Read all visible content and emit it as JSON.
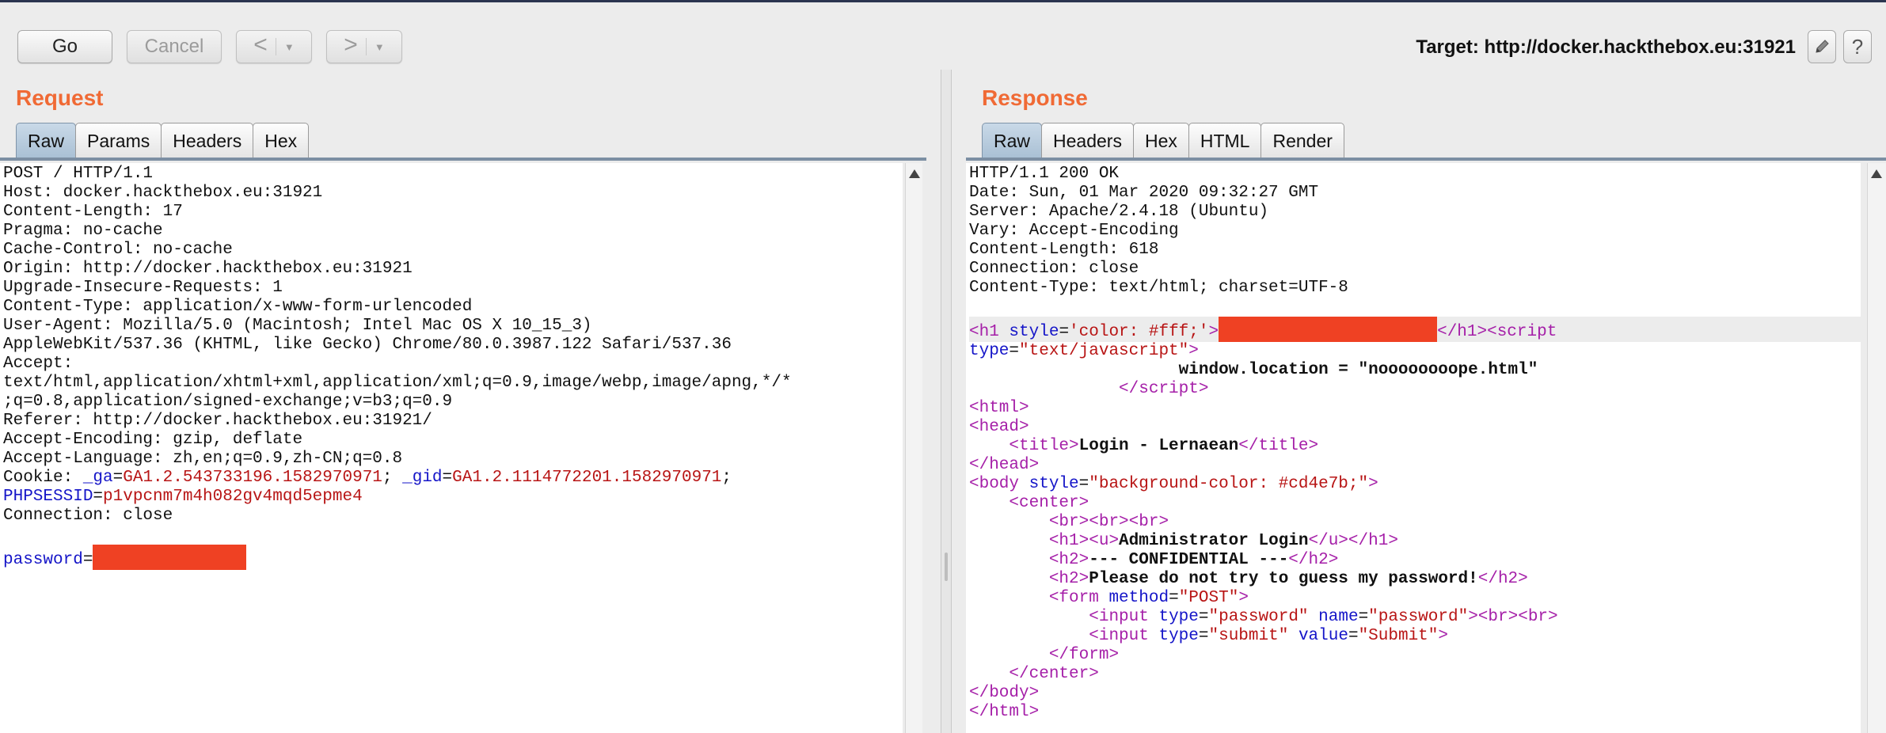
{
  "toolbar": {
    "go_label": "Go",
    "cancel_label": "Cancel",
    "back_arrow": "<",
    "forward_arrow": ">",
    "dropdown_glyph": "▼",
    "target_label": "Target: http://docker.hackthebox.eu:31921",
    "edit_icon": "pencil-icon",
    "help_label": "?"
  },
  "request": {
    "title": "Request",
    "tabs": [
      {
        "label": "Raw",
        "active": true
      },
      {
        "label": "Params"
      },
      {
        "label": "Headers"
      },
      {
        "label": "Hex"
      }
    ],
    "lines": [
      "POST / HTTP/1.1",
      "Host: docker.hackthebox.eu:31921",
      "Content-Length: 17",
      "Pragma: no-cache",
      "Cache-Control: no-cache",
      "Origin: http://docker.hackthebox.eu:31921",
      "Upgrade-Insecure-Requests: 1",
      "Content-Type: application/x-www-form-urlencoded",
      "User-Agent: Mozilla/5.0 (Macintosh; Intel Mac OS X 10_15_3)",
      "AppleWebKit/537.36 (KHTML, like Gecko) Chrome/80.0.3987.122 Safari/537.36",
      "Accept:",
      "text/html,application/xhtml+xml,application/xml;q=0.9,image/webp,image/apng,*/*",
      ";q=0.8,application/signed-exchange;v=b3;q=0.9",
      "Referer: http://docker.hackthebox.eu:31921/",
      "Accept-Encoding: gzip, deflate",
      "Accept-Language: zh,en;q=0.9,zh-CN;q=0.8"
    ],
    "cookie_prefix": "Cookie: ",
    "cookie_ga_key": "_ga",
    "cookie_ga_val": "GA1.2.543733196.1582970971",
    "cookie_gid_key": "_gid",
    "cookie_gid_val": "GA1.2.1114772201.1582970971",
    "phpsessid_key": "PHPSESSID",
    "phpsessid_val": "p1vpcnm7m4h082gv4mqd5epme4",
    "connection_line": "Connection: close",
    "password_key": "password"
  },
  "response": {
    "title": "Response",
    "tabs": [
      {
        "label": "Raw",
        "active": true
      },
      {
        "label": "Headers"
      },
      {
        "label": "Hex"
      },
      {
        "label": "HTML"
      },
      {
        "label": "Render"
      }
    ],
    "headers": [
      "HTTP/1.1 200 OK",
      "Date: Sun, 01 Mar 2020 09:32:27 GMT",
      "Server: Apache/2.4.18 (Ubuntu)",
      "Vary: Accept-Encoding",
      "Content-Length: 618",
      "Connection: close",
      "Content-Type: text/html; charset=UTF-8"
    ],
    "h1_style": "'color: #fff;'",
    "script_type": "\"text/javascript\"",
    "location_line": "window.location = \"noooooooope.html\"",
    "title_text": "Login - Lernaean",
    "body_style": "\"background-color: #cd4e7b;\"",
    "h1_text": "Administrator Login",
    "h2a_text": "--- CONFIDENTIAL ---",
    "h2b_text": "Please do not try to guess my password!",
    "form_method": "\"POST\"",
    "input1_type": "\"password\"",
    "input1_name": "\"password\"",
    "input2_type": "\"submit\"",
    "input2_value": "\"Submit\""
  },
  "colors": {
    "accent": "#f06a35",
    "redaction": "#ef4123",
    "tag": "#a51fa8",
    "attr": "#1515c8",
    "value": "#b81515"
  }
}
